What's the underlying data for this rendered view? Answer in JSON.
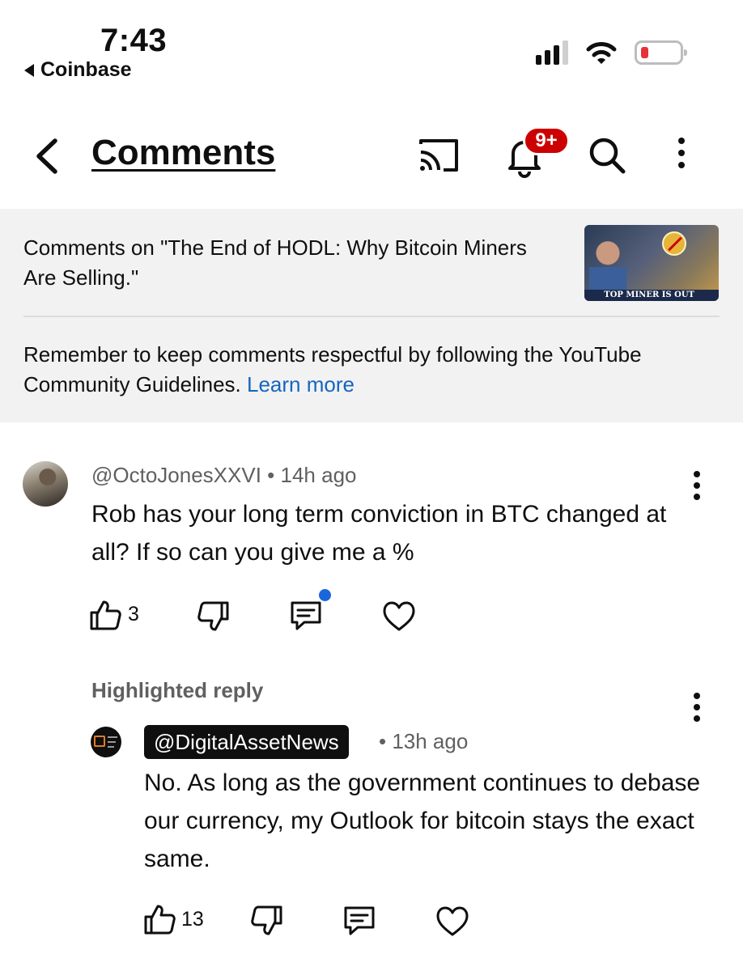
{
  "status_bar": {
    "time": "7:43",
    "back_app": "Coinbase"
  },
  "header": {
    "title": "Comments",
    "notification_badge": "9+"
  },
  "video_info": {
    "comments_on": "Comments on \"The End of HODL: Why Bitcoin Miners Are Selling.\"",
    "thumbnail_caption": "TOP MINER IS OUT",
    "guidelines_text": "Remember to keep comments respectful by following the YouTube Community Guidelines. ",
    "learn_more": "Learn more"
  },
  "comment": {
    "author": "@OctoJonesXXVI",
    "separator": " • ",
    "time": "14h ago",
    "text": "Rob has your long term conviction in BTC changed at all? If so can you give me a %",
    "likes": "3"
  },
  "reply": {
    "label": "Highlighted reply",
    "author": "@DigitalAssetNews",
    "time": "• 13h ago",
    "text": "No. As long as the government continues to debase our currency, my Outlook for bitcoin stays the exact same.",
    "likes": "13"
  },
  "colors": {
    "accent_red": "#cc0000",
    "link_blue": "#1565c0",
    "unread_dot": "#1a66dd"
  }
}
